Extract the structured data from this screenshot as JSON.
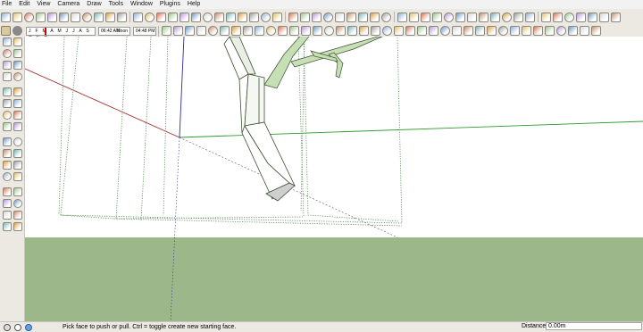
{
  "menu": [
    "File",
    "Edit",
    "View",
    "Camera",
    "Draw",
    "Tools",
    "Window",
    "Plugins",
    "Help"
  ],
  "shadow_settings": {
    "months": "J F M A M J J A S O N D",
    "time_start": "06:42 AM",
    "time_mid": "Noon",
    "time_end": "04:48 PM"
  },
  "status": {
    "message": "Pick face to push or pull.  Ctrl = toggle create new starting face.",
    "measurement_label": "Distance",
    "measurement_value": "0.00m"
  },
  "colors": {
    "sky": "#ffffff",
    "ground": "#9cb88a",
    "tree": "#c6dfb4",
    "tree_outline": "#3d4f33",
    "red_axis": "#a33030",
    "green_axis": "#2e9a2e",
    "blue_axis": "#2c2ca0"
  },
  "toolbar_icons": {
    "top": [
      "new-icon",
      "open-icon",
      "save-icon",
      "cut-icon",
      "copy-icon",
      "paste-icon",
      "erase-icon",
      "undo-icon",
      "redo-icon",
      "print-icon",
      "model-info-icon",
      "orbit-icon",
      "pan-icon",
      "zoom-icon",
      "zoom-window-icon",
      "zoom-extents-icon",
      "previous-view-icon",
      "next-view-icon",
      "iso-view-icon",
      "top-view-icon",
      "front-view-icon",
      "right-view-icon",
      "back-view-icon",
      "left-view-icon",
      "xray-icon",
      "wireframe-icon",
      "hidden-line-icon",
      "shaded-icon",
      "shaded-texture-icon",
      "monochrome-icon",
      "section-plane-icon",
      "section-display-icon",
      "section-cut-icon",
      "shadows-icon",
      "fog-icon",
      "walk-icon",
      "look-around-icon",
      "position-camera-icon",
      "add-location-icon",
      "toggle-terrain-icon",
      "photo-textures-icon",
      "get-models-icon",
      "share-model-icon",
      "share-component-icon",
      "preview-earth-icon",
      "sandbox-icon",
      "sandbox-scratch-icon",
      "smoove-icon",
      "stamp-icon",
      "drape-icon",
      "add-detail-icon",
      "flip-edge-icon"
    ],
    "second": [
      "select-icon",
      "make-component-icon",
      "paint-icon",
      "eraser-icon",
      "rectangle-icon",
      "line-icon",
      "circle-icon",
      "arc-icon",
      "polygon-icon",
      "freehand-icon",
      "move-icon",
      "push-pull-icon",
      "rotate-icon",
      "follow-me-icon",
      "scale-icon",
      "offset-icon",
      "tape-icon",
      "dimension-icon",
      "protractor-icon",
      "text-icon",
      "axes-icon",
      "3d-text-icon",
      "orbit2-icon",
      "pan2-icon",
      "zoom2-icon",
      "zoom-extents2-icon",
      "position-icon",
      "walk2-icon",
      "look-icon",
      "section-icon",
      "style-builder-icon",
      "layout-icon",
      "send-layout-icon",
      "dynamic-component-icon",
      "component-options-icon",
      "component-attributes-icon",
      "solid-union-icon",
      "solid-subtract-icon"
    ]
  }
}
